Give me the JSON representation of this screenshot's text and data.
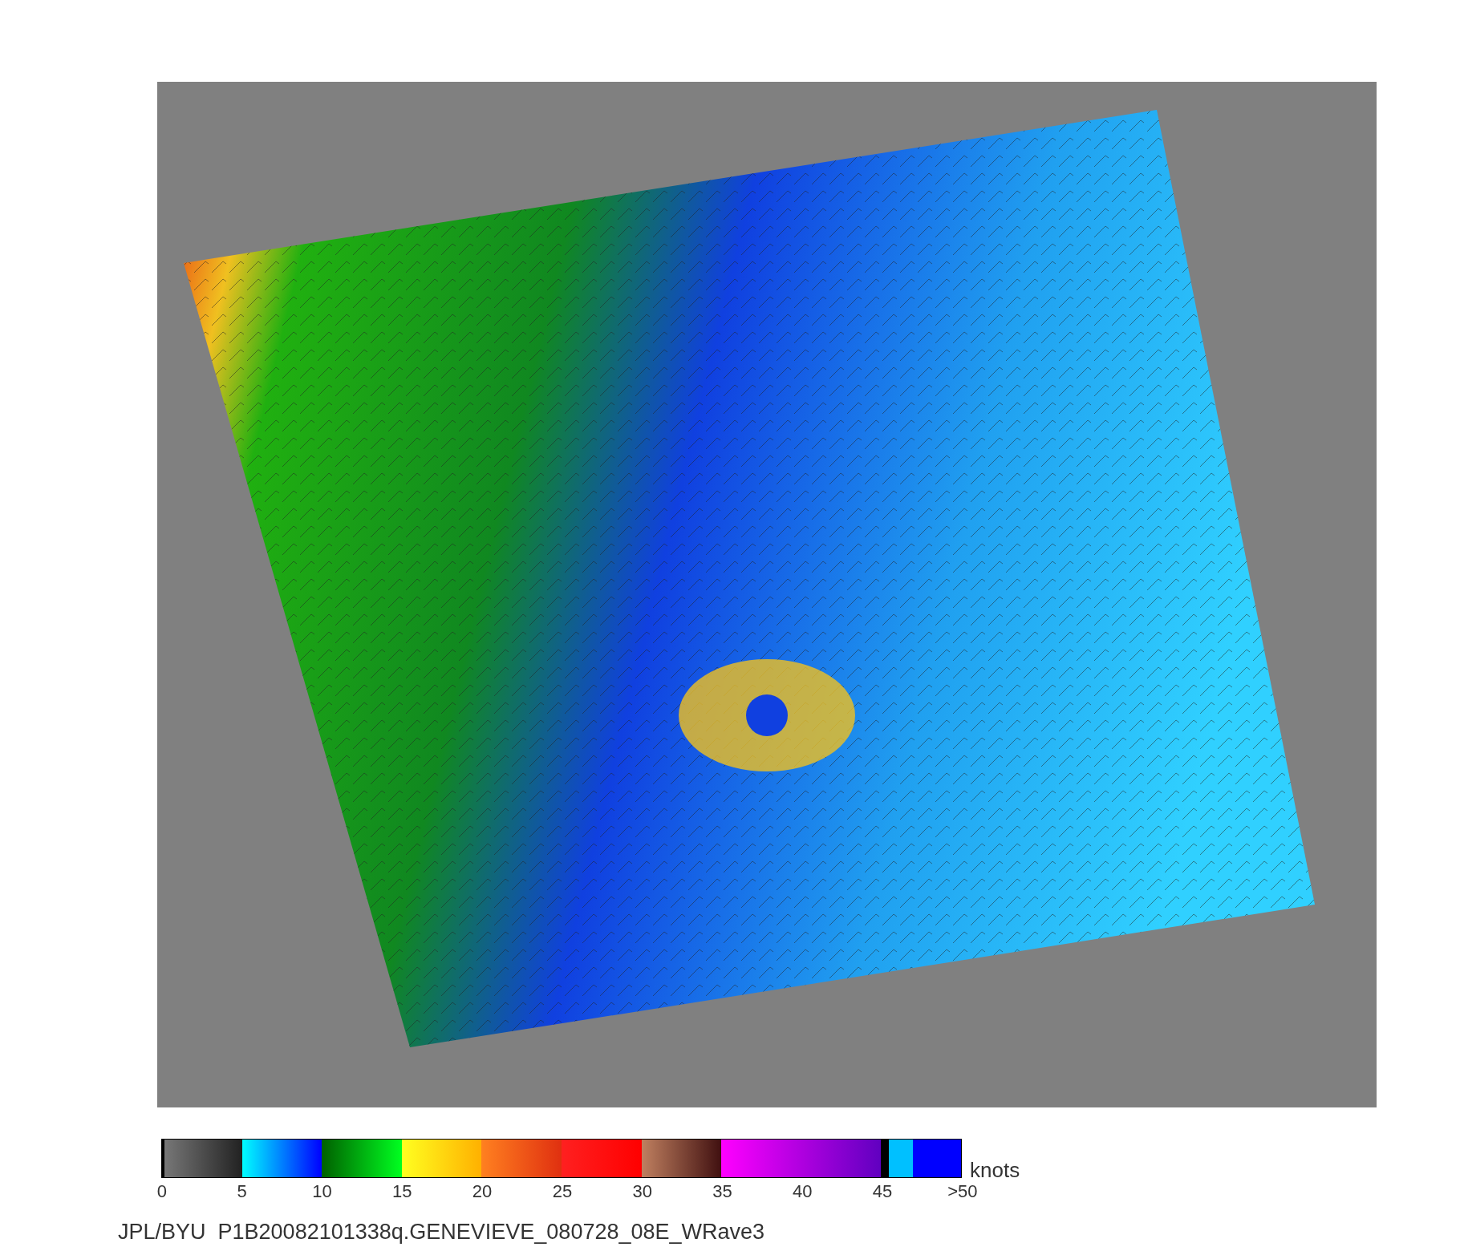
{
  "colorbar": {
    "unit": "knots",
    "ticks": [
      "0",
      "5",
      "10",
      "15",
      "20",
      "25",
      "30",
      "35",
      "40",
      "45",
      ">50"
    ]
  },
  "caption": "JPL/BYU  P1B20082101338q.GENEVIEVE_080728_08E_WRave3"
}
